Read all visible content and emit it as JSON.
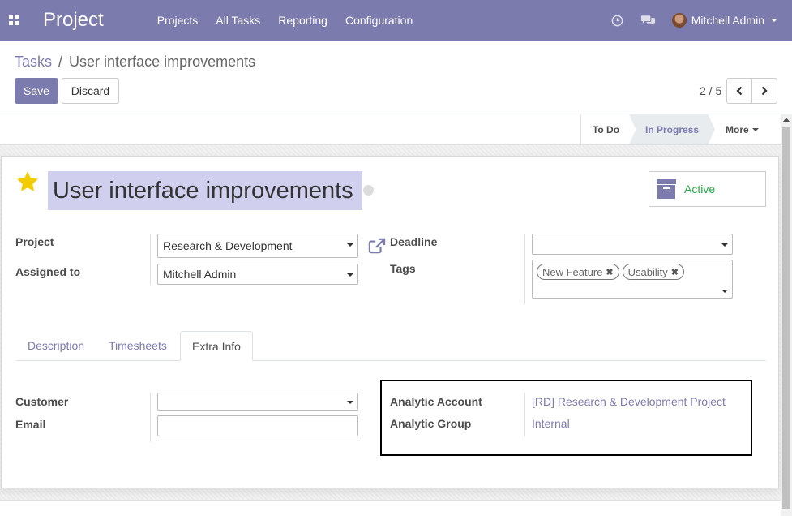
{
  "navbar": {
    "brand": "Project",
    "menu": [
      "Projects",
      "All Tasks",
      "Reporting",
      "Configuration"
    ],
    "user_name": "Mitchell Admin",
    "icons": [
      "apps-icon",
      "clock-icon",
      "chat-icon",
      "chevron-down-icon"
    ]
  },
  "breadcrumb": {
    "parent": "Tasks",
    "separator": "/",
    "current": "User interface improvements"
  },
  "buttons": {
    "save": "Save",
    "discard": "Discard"
  },
  "pager": {
    "value": "2 / 5"
  },
  "stages": {
    "todo": "To Do",
    "in_progress": "In Progress",
    "more": "More",
    "current": "In Progress"
  },
  "task": {
    "title": "User interface improvements",
    "active_label": "Active",
    "starred": true
  },
  "fields": {
    "project_label": "Project",
    "project_value": "Research & Development",
    "assigned_label": "Assigned to",
    "assigned_value": "Mitchell Admin",
    "deadline_label": "Deadline",
    "deadline_value": "",
    "tags_label": "Tags",
    "tags": [
      "New Feature",
      "Usability"
    ]
  },
  "tabs": {
    "items": [
      "Description",
      "Timesheets",
      "Extra Info"
    ],
    "active": "Extra Info"
  },
  "extra_info": {
    "customer_label": "Customer",
    "customer_value": "",
    "email_label": "Email",
    "email_value": "",
    "analytic_account_label": "Analytic Account",
    "analytic_account_value": "[RD] Research & Development Project",
    "analytic_group_label": "Analytic Group",
    "analytic_group_value": "Internal"
  },
  "colors": {
    "brand": "#7c7bad",
    "active": "#28a745",
    "star": "#f3cc00"
  }
}
